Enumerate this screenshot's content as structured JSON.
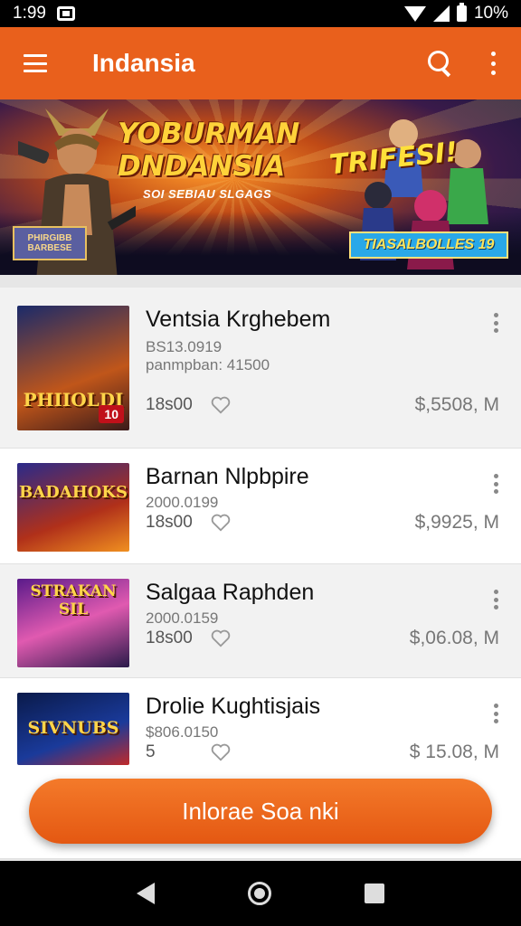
{
  "status_bar": {
    "time": "1:99",
    "battery": "10%"
  },
  "app_bar": {
    "title": "Indansia"
  },
  "banner": {
    "headline_line1": "YOBURMAN",
    "headline_line2": "DNDANSIA",
    "sub": "SOI SEBIAU SLGAGS",
    "side_label": "PHIRGIBB BARBESE",
    "promo": "TRIFESI!",
    "badge": "TIASALBOLLES 19"
  },
  "list": {
    "items": [
      {
        "name": "Ventsia Krghebem",
        "meta1": "BS13.0919",
        "meta2": "panmpban: 41500",
        "count": "18s00",
        "price": "$,5508, M",
        "thumb_text": "PHIIOLDI",
        "thumb_badge": "10"
      },
      {
        "name": "Barnan Nlpbpire",
        "meta1": "2000.0199",
        "meta2": "",
        "count": "18s00",
        "price": "$,9925, M",
        "thumb_text": "BADAHOKS",
        "thumb_badge": ""
      },
      {
        "name": "Salgaa Raphden",
        "meta1": "2000.0159",
        "meta2": "",
        "count": "18s00",
        "price": "$,06.08, M",
        "thumb_text": "STRAKAN SIL",
        "thumb_badge": ""
      },
      {
        "name": "Drolie Kughtisjais",
        "meta1": "$806.0150",
        "meta2": "",
        "count": "5",
        "price": "$ 15.08, M",
        "thumb_text": "SIVNUBS",
        "thumb_badge": ""
      }
    ]
  },
  "cta": {
    "label": "Inlorae Soa nki"
  },
  "colors": {
    "accent": "#e9601c"
  }
}
